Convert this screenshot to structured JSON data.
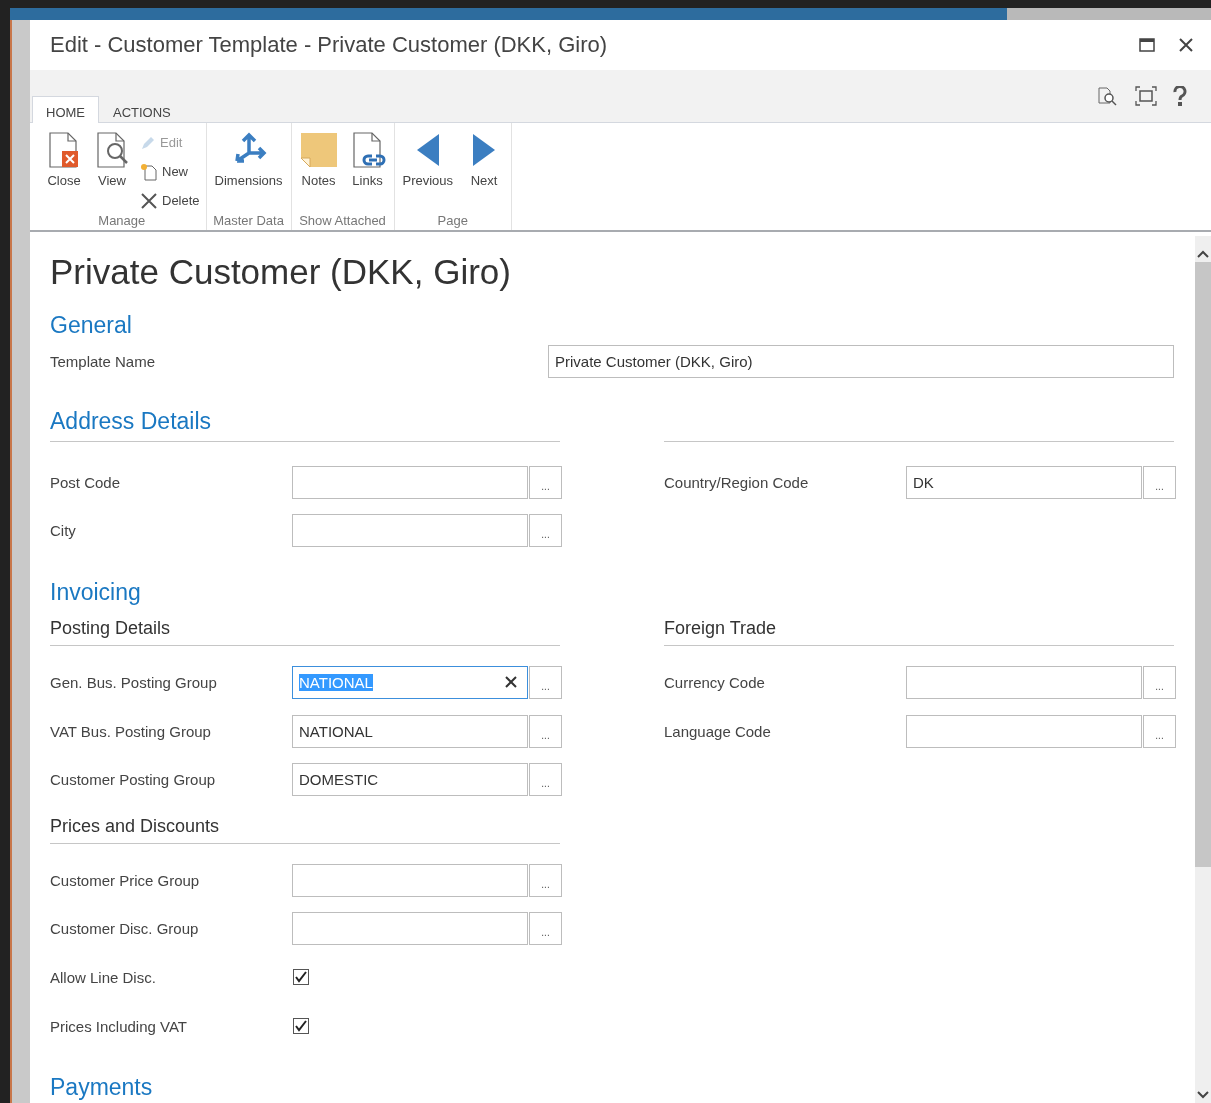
{
  "window": {
    "title": "Edit - Customer Template - Private Customer (DKK, Giro)"
  },
  "ribbon": {
    "tabs": [
      {
        "label": "HOME",
        "selected": true
      },
      {
        "label": "ACTIONS",
        "selected": false
      }
    ],
    "groups": [
      {
        "label": "Manage",
        "actions": [
          {
            "label": "Close",
            "kind": "close",
            "compact": false,
            "disabled": false
          },
          {
            "label": "View",
            "kind": "view",
            "compact": false,
            "disabled": false
          },
          {
            "label": "Edit",
            "kind": "edit",
            "compact": true,
            "disabled": true
          },
          {
            "label": "New",
            "kind": "new",
            "compact": true,
            "disabled": false
          },
          {
            "label": "Delete",
            "kind": "delete",
            "compact": true,
            "disabled": false
          }
        ]
      },
      {
        "label": "Master Data",
        "actions": [
          {
            "label": "Dimensions",
            "kind": "dimensions",
            "compact": false,
            "disabled": false
          }
        ]
      },
      {
        "label": "Show Attached",
        "actions": [
          {
            "label": "Notes",
            "kind": "notes",
            "compact": false,
            "disabled": false
          },
          {
            "label": "Links",
            "kind": "links",
            "compact": false,
            "disabled": false
          }
        ]
      },
      {
        "label": "Page",
        "actions": [
          {
            "label": "Previous",
            "kind": "previous",
            "compact": false,
            "disabled": false
          },
          {
            "label": "Next",
            "kind": "next",
            "compact": false,
            "disabled": false
          }
        ]
      }
    ]
  },
  "page_title": "Private Customer (DKK, Giro)",
  "sections": [
    {
      "title": "General",
      "kind": "wide",
      "rows": [
        {
          "label": "Template Name",
          "value": "Private Customer (DKK, Giro)"
        }
      ]
    },
    {
      "title": "Address Details",
      "kind": "columns",
      "columns": [
        [
          {
            "rows": [
              {
                "kind": "field",
                "label": "Post Code",
                "lookup": "..."
              },
              {
                "kind": "field",
                "label": "City",
                "lookup": "..."
              }
            ]
          }
        ],
        [
          {
            "rows": [
              {
                "kind": "field",
                "label": "Country/Region Code",
                "value": "DK",
                "lookup": "..."
              }
            ]
          }
        ]
      ]
    },
    {
      "title": "Invoicing",
      "kind": "columns",
      "columns": [
        [
          {
            "subtitle": "Posting Details",
            "rows": [
              {
                "kind": "field",
                "label": "Gen. Bus. Posting Group",
                "value": "NATIONAL",
                "lookup": "...",
                "focused": true
              },
              {
                "kind": "field",
                "label": "VAT Bus. Posting Group",
                "value": "NATIONAL",
                "lookup": "...",
                "focused": false
              },
              {
                "kind": "field",
                "label": "Customer Posting Group",
                "value": "DOMESTIC",
                "lookup": "...",
                "focused": false
              }
            ]
          },
          {
            "subtitle": "Prices and Discounts",
            "rows": [
              {
                "kind": "field",
                "label": "Customer Price Group",
                "lookup": "..."
              },
              {
                "kind": "field",
                "label": "Customer Disc. Group",
                "lookup": "..."
              },
              {
                "kind": "checkbox",
                "label": "Allow Line Disc.",
                "checked": true
              },
              {
                "kind": "checkbox",
                "label": "Prices Including VAT",
                "checked": true
              }
            ]
          }
        ],
        [
          {
            "subtitle": "Foreign Trade",
            "rows": [
              {
                "kind": "field",
                "label": "Currency Code",
                "lookup": "..."
              },
              {
                "kind": "field",
                "label": "Language Code",
                "lookup": "..."
              }
            ]
          }
        ]
      ]
    },
    {
      "title": "Payments",
      "kind": "heading"
    }
  ]
}
